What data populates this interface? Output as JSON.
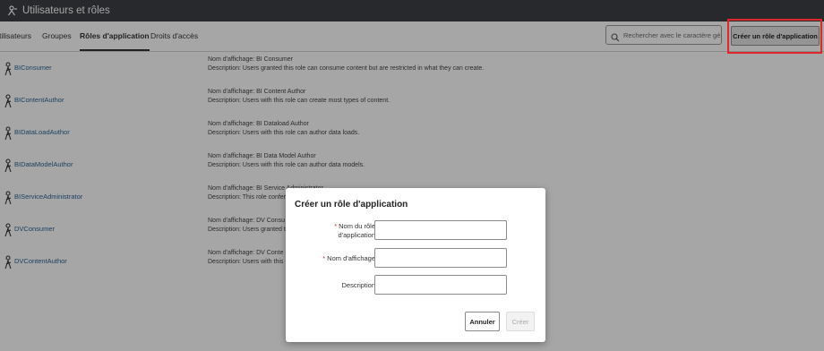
{
  "header": {
    "title": "Utilisateurs et rôles"
  },
  "tabs": [
    {
      "label": "Utilisateurs"
    },
    {
      "label": "Groupes"
    },
    {
      "label": "Rôles d'application"
    },
    {
      "label": "Droits d'accès"
    }
  ],
  "search": {
    "placeholder": "Rechercher avec le caractère gén"
  },
  "toolbar": {
    "create_label": "Créer un rôle d'application"
  },
  "roles": [
    {
      "name": "BIConsumer",
      "display": "Nom d'affichage: BI Consumer",
      "description": "Description: Users granted this role can consume content but are restricted in what they can create."
    },
    {
      "name": "BIContentAuthor",
      "display": "Nom d'affichage: BI Content Author",
      "description": "Description: Users with this role can create most types of content."
    },
    {
      "name": "BIDataLoadAuthor",
      "display": "Nom d'affichage: BI Dataload Author",
      "description": "Description: Users with this role can author data loads."
    },
    {
      "name": "BIDataModelAuthor",
      "display": "Nom d'affichage: BI Data Model Author",
      "description": "Description: Users with this role can author data models."
    },
    {
      "name": "BIServiceAdministrator",
      "display": "Nom d'affichage: BI Service Administrator",
      "description": "Description: This role confers"
    },
    {
      "name": "DVConsumer",
      "display": "Nom d'affichage: DV Consu",
      "description": "Description: Users granted t"
    },
    {
      "name": "DVContentAuthor",
      "display": "Nom d'affichage: DV Conte",
      "description": "Description: Users with this"
    }
  ],
  "dialog": {
    "title": "Créer un rôle d'application",
    "fields": [
      {
        "label_line1": "Nom du rôle",
        "label_line2": "d'application",
        "required": "*",
        "value": ""
      },
      {
        "label": "Nom d'affichage",
        "required": "*",
        "value": ""
      },
      {
        "label": "Description",
        "value": ""
      }
    ],
    "cancel_label": "Annuler",
    "create_label": "Créer"
  },
  "colors": {
    "topbar": "#3d4045",
    "link": "#2a6496",
    "highlight": "#e0262b"
  },
  "icons": {
    "header": "users-roles-icon",
    "row": "role-figure-icon",
    "search": "search-icon"
  }
}
